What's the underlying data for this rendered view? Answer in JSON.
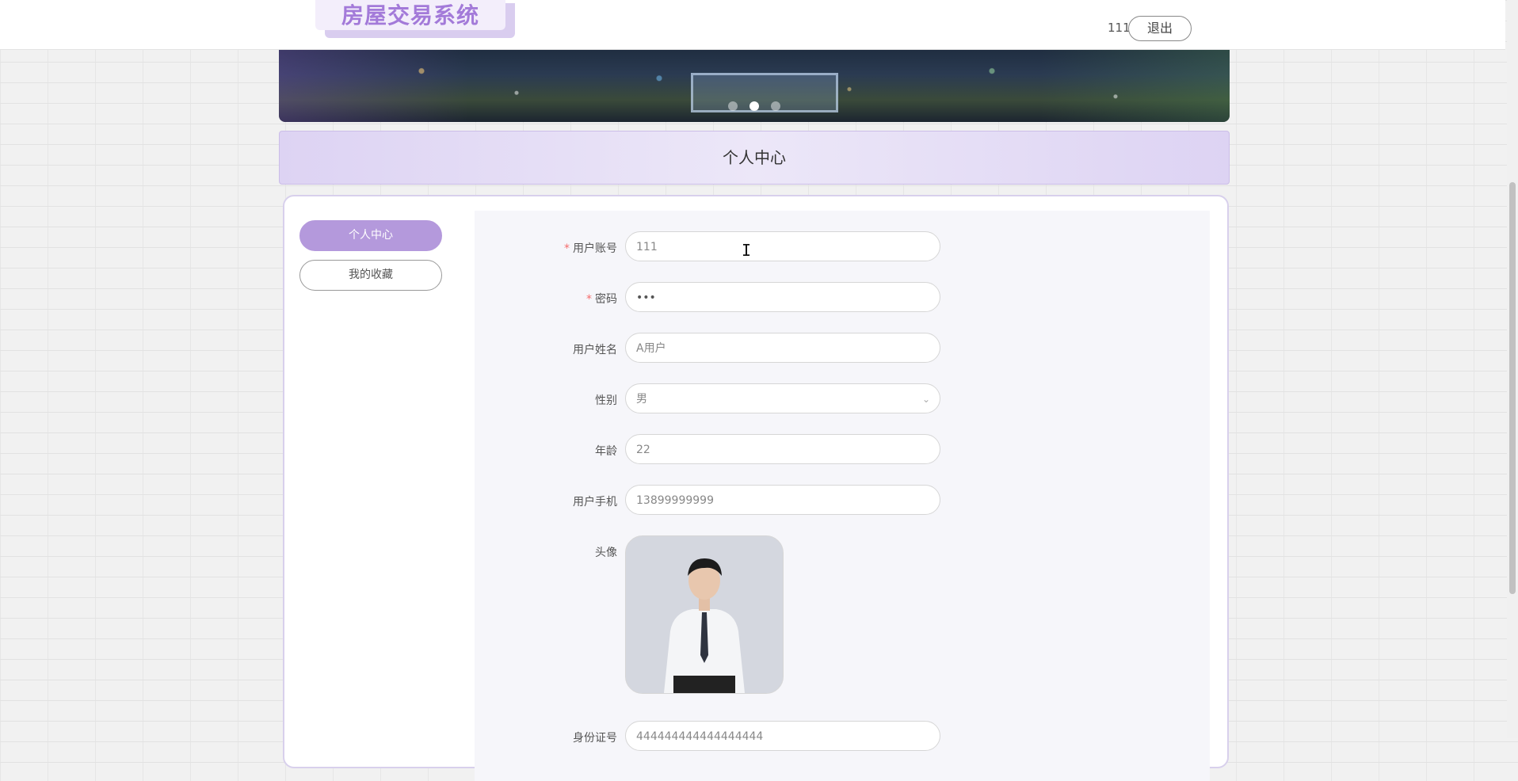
{
  "header": {
    "logo_text": "房屋交易系统",
    "username": "111",
    "logout_label": "退出"
  },
  "banner": {
    "slide_count": 3,
    "active_slide": 2
  },
  "page_title": "个人中心",
  "sidebar": {
    "items": [
      {
        "label": "个人中心",
        "active": true
      },
      {
        "label": "我的收藏",
        "active": false
      }
    ]
  },
  "form": {
    "account": {
      "label": "用户账号",
      "value": "111",
      "required": "*"
    },
    "password": {
      "label": "密码",
      "value": "•••",
      "required": "*"
    },
    "name": {
      "label": "用户姓名",
      "value": "A用户"
    },
    "gender": {
      "label": "性别",
      "value": "男"
    },
    "age": {
      "label": "年龄",
      "value": "22"
    },
    "phone": {
      "label": "用户手机",
      "value": "13899999999"
    },
    "avatar": {
      "label": "头像"
    },
    "id_card": {
      "label": "身份证号",
      "value": "444444444444444444"
    }
  },
  "colors": {
    "accent": "#b499dc",
    "logo": "#a37ad9",
    "required": "#f56c6c"
  }
}
